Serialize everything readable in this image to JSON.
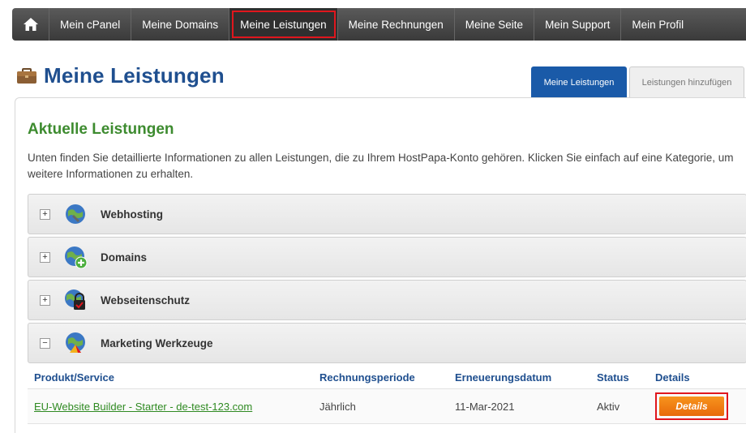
{
  "nav": {
    "home_icon": "home-icon",
    "items": [
      "Mein cPanel",
      "Meine Domains",
      "Meine Leistungen",
      "Meine Rechnungen",
      "Meine Seite",
      "Mein Support",
      "Mein Profil"
    ],
    "active_index": 2
  },
  "header": {
    "title": "Meine Leistungen",
    "icon": "briefcase-icon",
    "tabs": [
      "Meine Leistungen",
      "Leistungen hinzufügen"
    ]
  },
  "content": {
    "heading": "Aktuelle Leistungen",
    "intro": "Unten finden Sie detaillierte Informationen zu allen Leistungen, die zu Ihrem HostPapa-Konto gehören. Klicken Sie einfach auf eine Kategorie, um weitere Informationen zu erhalten."
  },
  "categories": [
    {
      "label": "Webhosting",
      "toggle": "+",
      "icon": "webhosting-globe-icon"
    },
    {
      "label": "Domains",
      "toggle": "+",
      "icon": "domains-globe-plus-icon"
    },
    {
      "label": "Webseitenschutz",
      "toggle": "+",
      "icon": "website-protection-lock-icon"
    },
    {
      "label": "Marketing Werkzeuge",
      "toggle": "−",
      "icon": "marketing-tools-icon"
    }
  ],
  "table": {
    "headers": [
      "Produkt/Service",
      "Rechnungsperiode",
      "Erneuerungsdatum",
      "Status",
      "Details"
    ],
    "rows": [
      {
        "product": "EU-Website Builder - Starter - de-test-123.com",
        "period": "Jährlich",
        "renewal": "11-Mar-2021",
        "status": "Aktiv",
        "details_label": "Details"
      }
    ]
  },
  "colors": {
    "nav_bg": "#444444",
    "title_blue": "#1f4f8f",
    "heading_green": "#3d8b2f",
    "highlight_red": "#e0161d",
    "button_orange": "#f07f14"
  }
}
